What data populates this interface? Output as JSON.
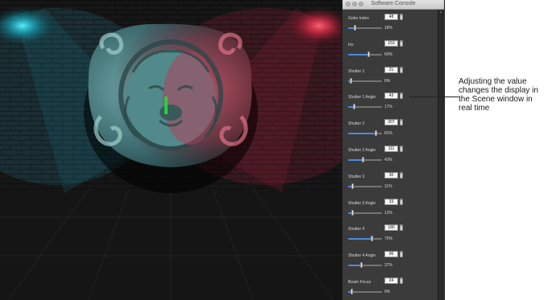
{
  "window": {
    "title": "Software Console"
  },
  "params": [
    {
      "label": "Gobo Index",
      "value": "48",
      "percent_text": "18%",
      "level": 0.18
    },
    {
      "label": "Iris",
      "value": "153",
      "percent_text": "60%",
      "level": 0.6
    },
    {
      "label": "Shutter 1",
      "value": "21",
      "percent_text": "8%",
      "level": 0.08
    },
    {
      "label": "Shutter 1 Angle",
      "value": "43",
      "percent_text": "17%",
      "level": 0.17
    },
    {
      "label": "Shutter 2",
      "value": "207",
      "percent_text": "81%",
      "level": 0.81
    },
    {
      "label": "Shutter 2 Angle",
      "value": "111",
      "percent_text": "43%",
      "level": 0.43
    },
    {
      "label": "Shutter 3",
      "value": "30",
      "percent_text": "11%",
      "level": 0.11
    },
    {
      "label": "Shutter 3 Angle",
      "value": "33",
      "percent_text": "12%",
      "level": 0.12
    },
    {
      "label": "Shutter 4",
      "value": "180",
      "percent_text": "70%",
      "level": 0.7
    },
    {
      "label": "Shutter 4 Angle",
      "value": "96",
      "percent_text": "37%",
      "level": 0.37
    },
    {
      "label": "Beam Focus",
      "value": "24",
      "percent_text": "9%",
      "level": 0.09
    }
  ],
  "callout": {
    "text": "Adjusting the value changes the display in the Scene window in real time"
  },
  "colors": {
    "slider_fill": "#4c8be0",
    "panel_bg": "#3b3b3b",
    "scene_bg": "#121212",
    "light_red": "#e6324f",
    "light_cyan": "#2ec0d0"
  }
}
